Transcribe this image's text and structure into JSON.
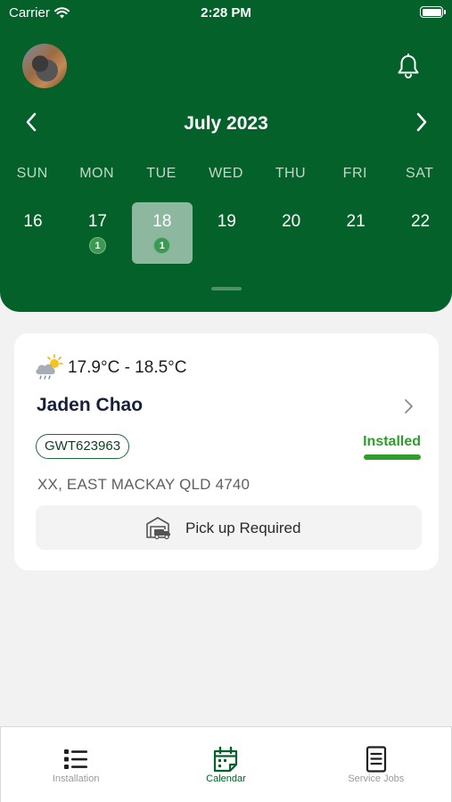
{
  "status_bar": {
    "carrier": "Carrier",
    "time": "2:28 PM"
  },
  "calendar": {
    "month_title": "July 2023",
    "weekdays": [
      "SUN",
      "MON",
      "TUE",
      "WED",
      "THU",
      "FRI",
      "SAT"
    ],
    "days": [
      {
        "num": "16",
        "badge": null,
        "selected": false
      },
      {
        "num": "17",
        "badge": "1",
        "selected": false
      },
      {
        "num": "18",
        "badge": "1",
        "selected": true
      },
      {
        "num": "19",
        "badge": null,
        "selected": false
      },
      {
        "num": "20",
        "badge": null,
        "selected": false
      },
      {
        "num": "21",
        "badge": null,
        "selected": false
      },
      {
        "num": "22",
        "badge": null,
        "selected": false
      }
    ]
  },
  "job_card": {
    "weather_icon": "cloud-sun-rain-icon",
    "temperature": "17.9°C - 18.5°C",
    "customer_name": "Jaden Chao",
    "job_id": "GWT623963",
    "status": "Installed",
    "address": "XX, EAST MACKAY QLD 4740",
    "pickup_icon": "garage-truck-icon",
    "pickup_label": "Pick up Required"
  },
  "tabs": [
    {
      "label": "Installation",
      "icon": "list-icon",
      "active": false
    },
    {
      "label": "Calendar",
      "icon": "calendar-icon",
      "active": true
    },
    {
      "label": "Service Jobs",
      "icon": "document-icon",
      "active": false
    }
  ],
  "colors": {
    "brand_green": "#046129",
    "status_green": "#2f9c2c",
    "background": "#f2f2f2"
  }
}
